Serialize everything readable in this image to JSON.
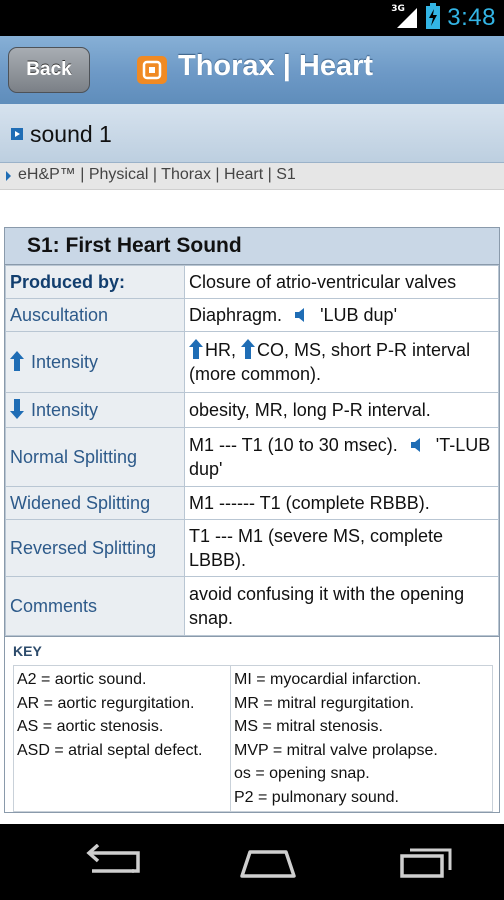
{
  "status_bar": {
    "network": "3G",
    "time": "3:48"
  },
  "title_bar": {
    "back_label": "Back",
    "title": "Thorax | Heart"
  },
  "section": {
    "label": "sound 1"
  },
  "breadcrumb": {
    "text": "eH&P™ | Physical | Thorax | Heart | S1"
  },
  "card": {
    "heading": "S1:   First Heart Sound",
    "rows": [
      {
        "label": "Produced by:",
        "value": "Closure of atrio-ventricular valves"
      },
      {
        "label": "Auscultation",
        "value_pre": "Diaphragm.",
        "value_post": "'LUB dup'"
      },
      {
        "label": "Intensity",
        "value_a": "HR,",
        "value_b": "CO, MS, short P-R interval (more common)."
      },
      {
        "label": "Intensity",
        "value": "obesity, MR, long P-R interval."
      },
      {
        "label": "Normal Splitting",
        "value_pre": "M1 --- T1 (10 to 30 msec).",
        "value_post": "'T-LUB dup'"
      },
      {
        "label": "Widened Splitting",
        "value": "M1 ------ T1 (complete RBBB)."
      },
      {
        "label": "Reversed Splitting",
        "value": "T1 --- M1 (severe MS, complete LBBB)."
      },
      {
        "label": "Comments",
        "value": "avoid confusing it with the opening snap."
      }
    ]
  },
  "key": {
    "title": "KEY",
    "left": [
      "A2 = aortic sound.",
      "AR = aortic regurgitation.",
      "AS = aortic stenosis.",
      "ASD = atrial septal defect."
    ],
    "right": [
      "MI = myocardial infarction.",
      "MR = mitral regurgitation.",
      "MS = mitral stenosis.",
      "MVP = mitral valve prolapse.",
      "os = opening snap.",
      "P2 = pulmonary sound."
    ]
  },
  "colors": {
    "accent": "#33b5e5",
    "titlebar": "#6d99c6",
    "label_text": "#2d5a8a",
    "arrow_blue": "#1f6db5",
    "app_icon": "#f08a24"
  },
  "icons": [
    "back-icon",
    "home-icon",
    "recent-apps-icon",
    "speaker-icon",
    "arrow-up-icon",
    "arrow-down-icon",
    "signal-icon",
    "battery-icon"
  ]
}
